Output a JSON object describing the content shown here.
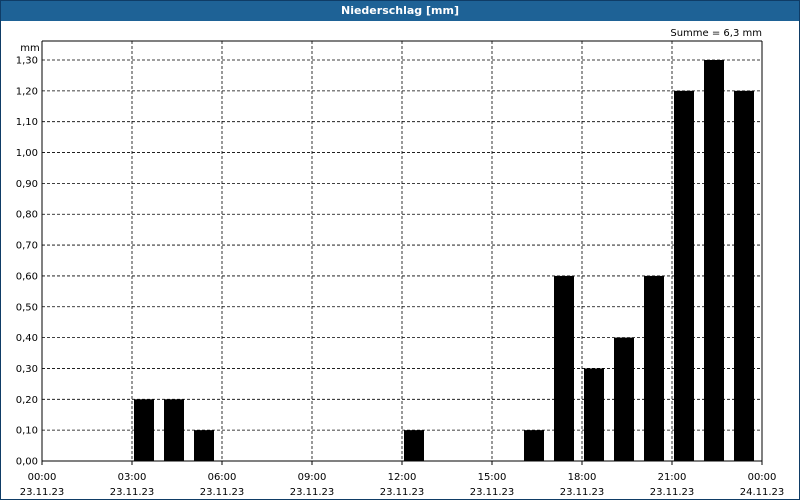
{
  "window": {
    "title": "Niederschlag [mm]"
  },
  "chart_data": {
    "type": "bar",
    "title": "Niederschlag [mm]",
    "ylabel": "mm",
    "annotation": "Summe = 6,3 mm",
    "ylim": [
      0,
      1.3
    ],
    "yticks": [
      "0,00",
      "0,10",
      "0,20",
      "0,30",
      "0,40",
      "0,50",
      "0,60",
      "0,70",
      "0,80",
      "0,90",
      "1,00",
      "1,10",
      "1,20",
      "1,30"
    ],
    "xlim_hours": [
      0,
      24
    ],
    "xticks": [
      {
        "hour": 0,
        "time": "00:00",
        "date": "23.11.23"
      },
      {
        "hour": 3,
        "time": "03:00",
        "date": "23.11.23"
      },
      {
        "hour": 6,
        "time": "06:00",
        "date": "23.11.23"
      },
      {
        "hour": 9,
        "time": "09:00",
        "date": "23.11.23"
      },
      {
        "hour": 12,
        "time": "12:00",
        "date": "23.11.23"
      },
      {
        "hour": 15,
        "time": "15:00",
        "date": "23.11.23"
      },
      {
        "hour": 18,
        "time": "18:00",
        "date": "23.11.23"
      },
      {
        "hour": 21,
        "time": "21:00",
        "date": "23.11.23"
      },
      {
        "hour": 24,
        "time": "00:00",
        "date": "24.11.23"
      }
    ],
    "bars": [
      {
        "hour": 3,
        "value": 0.2
      },
      {
        "hour": 4,
        "value": 0.2
      },
      {
        "hour": 5,
        "value": 0.1
      },
      {
        "hour": 12,
        "value": 0.1
      },
      {
        "hour": 16,
        "value": 0.1
      },
      {
        "hour": 17,
        "value": 0.6
      },
      {
        "hour": 18,
        "value": 0.3
      },
      {
        "hour": 19,
        "value": 0.4
      },
      {
        "hour": 20,
        "value": 0.6
      },
      {
        "hour": 21,
        "value": 1.2
      },
      {
        "hour": 22,
        "value": 1.3
      },
      {
        "hour": 23,
        "value": 1.2
      }
    ],
    "grid": true,
    "bar_color": "#000000"
  }
}
